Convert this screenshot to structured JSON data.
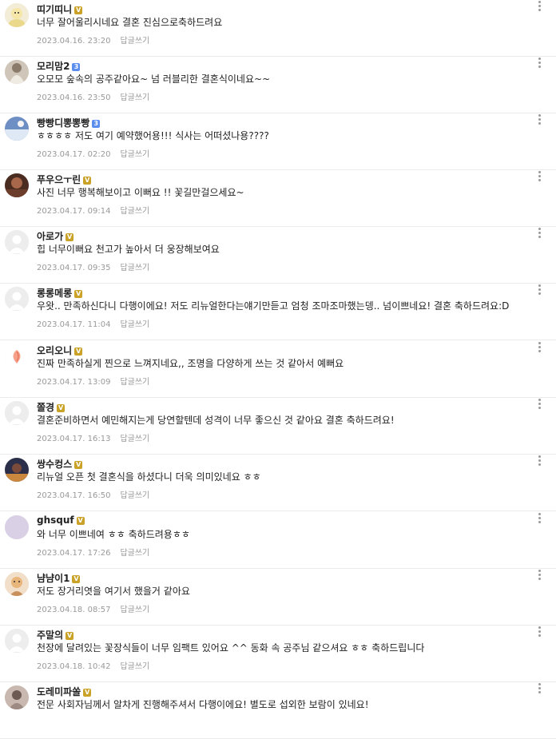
{
  "comments": [
    {
      "nickname": "띠기띠니",
      "badge": "V",
      "text": "너무 잘어울리시네요 결혼 진심으로축하드려요",
      "date": "2023.04.16. 23:20",
      "reply_label": "답글쓰기",
      "avatar": "person-icon"
    },
    {
      "nickname": "모리맘2",
      "badge": "3",
      "text": "오모모 숲속의 공주같아요~ 넘 러블리한 결혼식이네요~~",
      "date": "2023.04.16. 23:50",
      "reply_label": "답글쓰기",
      "avatar": "photo-icon"
    },
    {
      "nickname": "빵빵디뽕뽕빵",
      "badge": "3",
      "text": "ㅎㅎㅎㅎ 저도 여기 예약했어용!!! 식사는 어떠셨나용????",
      "date": "2023.04.17. 02:20",
      "reply_label": "답글쓰기",
      "avatar": "photo-icon"
    },
    {
      "nickname": "푸우으ㅜ린",
      "badge": "V",
      "text": "사진 너무 행복해보이고 이뻐요 !! 꽃길만걸으세요~",
      "date": "2023.04.17. 09:14",
      "reply_label": "답글쓰기",
      "avatar": "photo-icon"
    },
    {
      "nickname": "아로가",
      "badge": "V",
      "text": "힙 너무이뻐요 천고가 높아서 더 웅장해보여요",
      "date": "2023.04.17. 09:35",
      "reply_label": "답글쓰기",
      "avatar": "default-avatar-icon"
    },
    {
      "nickname": "롱롱메롱",
      "badge": "V",
      "text": "우왓.. 만족하신다니 다행이에요! 저도 리뉴얼한다는얘기만듣고 엄청 조마조마했는뎅.. 넘이쁘네요! 결혼 축하드려요:D",
      "date": "2023.04.17. 11:04",
      "reply_label": "답글쓰기",
      "avatar": "default-avatar-icon"
    },
    {
      "nickname": "오리오니",
      "badge": "V",
      "text": "진짜 만족하실게 찐으로 느껴지네요,, 조명을 다양하게 쓰는 것 같아서 예뻐요",
      "date": "2023.04.17. 13:09",
      "reply_label": "답글쓰기",
      "avatar": "peach-icon"
    },
    {
      "nickname": "쫄경",
      "badge": "V",
      "text": "결혼준비하면서 예민해지는게 당연할텐데 성격이 너무 좋으신 것 같아요 결혼 축하드려요!",
      "date": "2023.04.17. 16:13",
      "reply_label": "답글쓰기",
      "avatar": "default-avatar-icon"
    },
    {
      "nickname": "쌍수컹스",
      "badge": "V",
      "text": "리뉴얼 오픈 첫 결혼식을 하셨다니 더욱 의미있네요 ㅎㅎ",
      "date": "2023.04.17. 16:50",
      "reply_label": "답글쓰기",
      "avatar": "photo-icon"
    },
    {
      "nickname": "ghsquf",
      "badge": "V",
      "text": "와 너무 이쁘네여 ㅎㅎ 축하드려용ㅎㅎ",
      "date": "2023.04.17. 17:26",
      "reply_label": "답글쓰기",
      "avatar": "plain-avatar-icon"
    },
    {
      "nickname": "냠냠이1",
      "badge": "V",
      "text": "저도 장거리엿을 여기서 했을거 같아요",
      "date": "2023.04.18. 08:57",
      "reply_label": "답글쓰기",
      "avatar": "photo-icon"
    },
    {
      "nickname": "주말의",
      "badge": "V",
      "text": "천장에 달려있는 꽃장식들이 너무 임팩트 있어요 ^^ 동화 속 공주님 같으셔요 ㅎㅎ 축하드립니다",
      "date": "2023.04.18. 10:42",
      "reply_label": "답글쓰기",
      "avatar": "default-avatar-icon"
    },
    {
      "nickname": "도레미파쏠",
      "badge": "V",
      "text": "전문 사회자님께서 알차게 진행해주셔서 다행이에요! 별도로 섭외한 보람이 있네요!",
      "date": "",
      "reply_label": "",
      "avatar": "photo-icon"
    }
  ],
  "colors": {
    "badge_gold": "#c9a227",
    "badge_blue": "#5b8def"
  }
}
